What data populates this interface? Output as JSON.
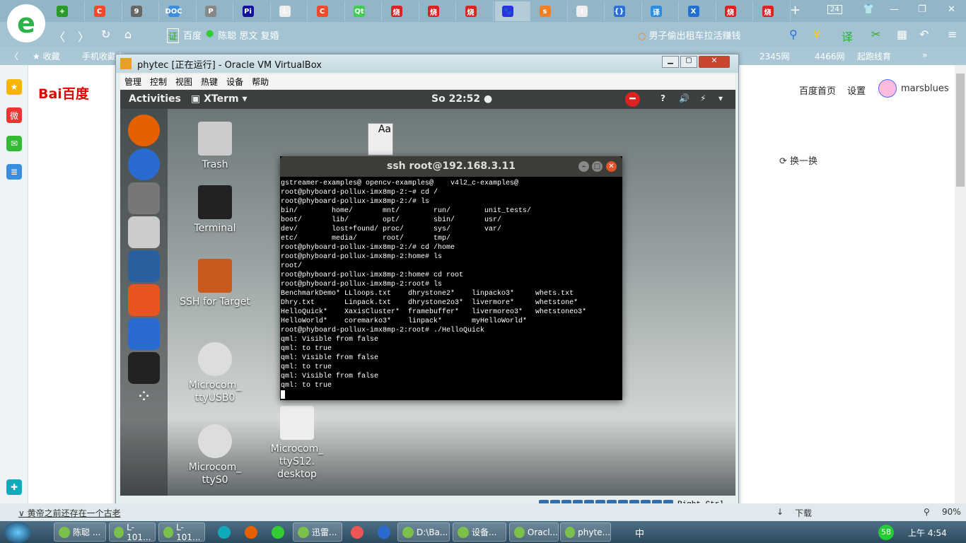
{
  "browser": {
    "tabs": [
      {
        "icon": "plus-circle",
        "color": "#2a9a2a",
        "label": "+"
      },
      {
        "icon": "csdn",
        "color": "#f04a2a",
        "label": "C"
      },
      {
        "icon": "tab-icon",
        "color": "#666",
        "label": "9"
      },
      {
        "icon": "doc",
        "color": "#3a8ee0",
        "label": "DOC"
      },
      {
        "icon": "tab-icon",
        "color": "#888",
        "label": "P"
      },
      {
        "icon": "tab-icon",
        "color": "#119",
        "label": "Pi"
      },
      {
        "icon": "file",
        "color": "#eee",
        "label": "L"
      },
      {
        "icon": "csdn",
        "color": "#f04a2a",
        "label": "C"
      },
      {
        "icon": "qt",
        "color": "#41cd52",
        "label": "Qt"
      },
      {
        "icon": "red",
        "color": "#d22",
        "label": "烧"
      },
      {
        "icon": "red",
        "color": "#d22",
        "label": "烧"
      },
      {
        "icon": "red",
        "color": "#d22",
        "label": "烧"
      },
      {
        "icon": "baidu-paw",
        "color": "#2932e1",
        "label": "🐾"
      },
      {
        "icon": "stackoverflow",
        "color": "#f48024",
        "label": "s"
      },
      {
        "icon": "file",
        "color": "#eee",
        "label": "I"
      },
      {
        "icon": "braces",
        "color": "#2b6fd6",
        "label": "{}"
      },
      {
        "icon": "translate",
        "color": "#2b8ee0",
        "label": "译"
      },
      {
        "icon": "x",
        "color": "#1f6fd6",
        "label": "X"
      },
      {
        "icon": "red",
        "color": "#d22",
        "label": "烧"
      },
      {
        "icon": "red",
        "color": "#d22",
        "label": "烧"
      }
    ],
    "tab_count": "24",
    "address": {
      "cert": "证",
      "site": "百度",
      "query": "陈聪 思文 复婚"
    },
    "search_text": "男子偷出租车拉活赚钱",
    "bookmarks": [
      "收藏",
      "手机收藏夹",
      "2345网",
      "4466网",
      "起跑线育"
    ],
    "status_news": "黄帝之前还存在一个古老",
    "status_right": [
      "下载",
      "90%"
    ]
  },
  "baidu": {
    "logo": "Bai百度",
    "links": [
      "百度首页",
      "设置"
    ],
    "user": "marsblues",
    "refresh": "换一换"
  },
  "virtualbox": {
    "title": "phytec [正在运行] - Oracle VM VirtualBox",
    "menu": [
      "管理",
      "控制",
      "视图",
      "热键",
      "设备",
      "帮助"
    ],
    "host_key": "Right Ctrl"
  },
  "gnome": {
    "activities": "Activities",
    "app": "XTerm",
    "clock": "So 22:52",
    "desktop_icons": [
      {
        "label": "Trash",
        "icon": "trash"
      },
      {
        "label": "Terminal",
        "icon": "terminal"
      },
      {
        "label": "SSH for Target",
        "icon": "monitors"
      },
      {
        "label": "Microcom_ ttyUSB0",
        "icon": "gear"
      },
      {
        "label": "Microcom_ ttyS0",
        "icon": "gear"
      },
      {
        "label": "Microcom_ ttyS12. desktop",
        "icon": "text-file"
      }
    ],
    "dock": [
      "firefox",
      "thunderbird",
      "files",
      "rhythmbox",
      "libreoffice-writer",
      "software-center",
      "help",
      "xterm",
      "app-grid"
    ]
  },
  "terminal": {
    "title": "ssh root@192.168.3.11",
    "lines": [
      "gstreamer-examples@ opencv-examples@    v4l2_c-examples@",
      "root@phyboard-pollux-imx8mp-2:~# cd /",
      "root@phyboard-pollux-imx8mp-2:/# ls",
      "bin/        home/       mnt/        run/        unit_tests/",
      "boot/       lib/        opt/        sbin/       usr/",
      "dev/        lost+found/ proc/       sys/        var/",
      "etc/        media/      root/       tmp/",
      "root@phyboard-pollux-imx8mp-2:/# cd /home",
      "root@phyboard-pollux-imx8mp-2:home# ls",
      "root/",
      "root@phyboard-pollux-imx8mp-2:home# cd root",
      "root@phyboard-pollux-imx8mp-2:root# ls",
      "BenchmarkDemo* LLloops.txt    dhrystone2*    linpacko3*     whets.txt",
      "Dhry.txt       Linpack.txt    dhrystone2o3*  livermore*     whetstone*",
      "HelloQuick*    XaxisCluster*  framebuffer*   livermoreo3*   whetstoneo3*",
      "HelloWorld*    coremarko3*    linpack*       myHelloWorld*",
      "root@phyboard-pollux-imx8mp-2:root# ./HelloQuick",
      "qml: Visible from false",
      "qml: to true",
      "qml: Visible from false",
      "qml: to true",
      "qml: Visible from false",
      "qml: to true"
    ]
  },
  "taskbar": {
    "items": [
      "陈聪 ...",
      "L-101...",
      "L-101...",
      "迅雷...",
      "D:\\Ba...",
      "设备...",
      "Oracl...",
      "phyte..."
    ],
    "ime": "中",
    "badge": "58",
    "time": "上午 4:54"
  }
}
